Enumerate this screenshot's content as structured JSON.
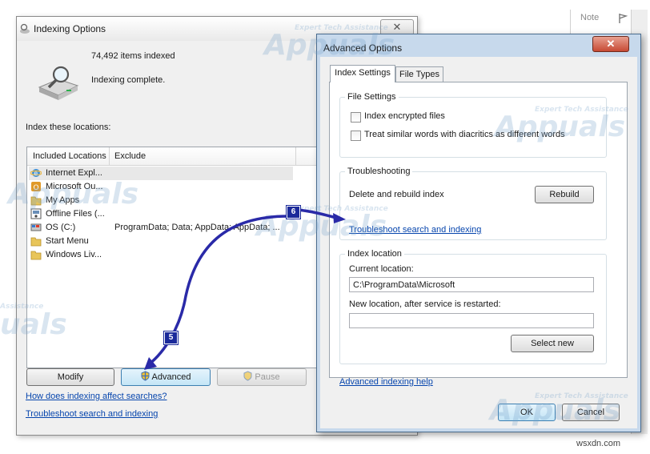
{
  "background": {
    "note_label": "Note"
  },
  "main_window": {
    "title": "Indexing Options",
    "items_indexed": "74,492 items indexed",
    "status": "Indexing complete.",
    "locations_label": "Index these locations:",
    "columns": {
      "included": "Included Locations",
      "exclude": "Exclude"
    },
    "locations": [
      {
        "name": "Internet Expl...",
        "exclude": "",
        "icon": "ie-icon"
      },
      {
        "name": "Microsoft Ou...",
        "exclude": "",
        "icon": "outlook-icon"
      },
      {
        "name": "My Apps",
        "exclude": "",
        "icon": "folder-icon"
      },
      {
        "name": "Offline Files (...",
        "exclude": "",
        "icon": "offline-files-icon"
      },
      {
        "name": "OS (C:)",
        "exclude": "ProgramData; Data; AppData; AppData; ...",
        "icon": "drive-icon"
      },
      {
        "name": "Start Menu",
        "exclude": "",
        "icon": "folder-icon"
      },
      {
        "name": "Windows Liv...",
        "exclude": "",
        "icon": "folder-icon"
      }
    ],
    "buttons": {
      "modify": "Modify",
      "advanced": "Advanced",
      "pause": "Pause"
    },
    "links": {
      "how_affect": "How does indexing affect searches?",
      "troubleshoot": "Troubleshoot search and indexing"
    }
  },
  "advanced_window": {
    "title": "Advanced Options",
    "tabs": [
      "Index Settings",
      "File Types"
    ],
    "file_settings": {
      "title": "File Settings",
      "encrypt_label": "Index encrypted files",
      "diacritics_label": "Treat similar words with diacritics as different words"
    },
    "troubleshooting": {
      "title": "Troubleshooting",
      "rebuild_text": "Delete and rebuild index",
      "rebuild_button": "Rebuild",
      "link": "Troubleshoot search and indexing"
    },
    "index_location": {
      "title": "Index location",
      "current_label": "Current location:",
      "current_value": "C:\\ProgramData\\Microsoft",
      "new_label": "New location, after service is restarted:",
      "new_value": "",
      "select_button": "Select new"
    },
    "help_link": "Advanced indexing help",
    "ok": "OK",
    "cancel": "Cancel"
  },
  "annotations": {
    "step5": "5",
    "step6": "6",
    "arrow_color": "#2a2aa8"
  },
  "watermarks": {
    "brand": "Appuals",
    "tagline": "Expert Tech Assistance",
    "partial": "uals",
    "partial_tagline": "Assistance"
  },
  "footer": {
    "credit": "wsxdn.com"
  },
  "colors": {
    "link": "#0645ad",
    "dialog_frame": "#c7d9ec",
    "close_red": "#c74a34"
  }
}
